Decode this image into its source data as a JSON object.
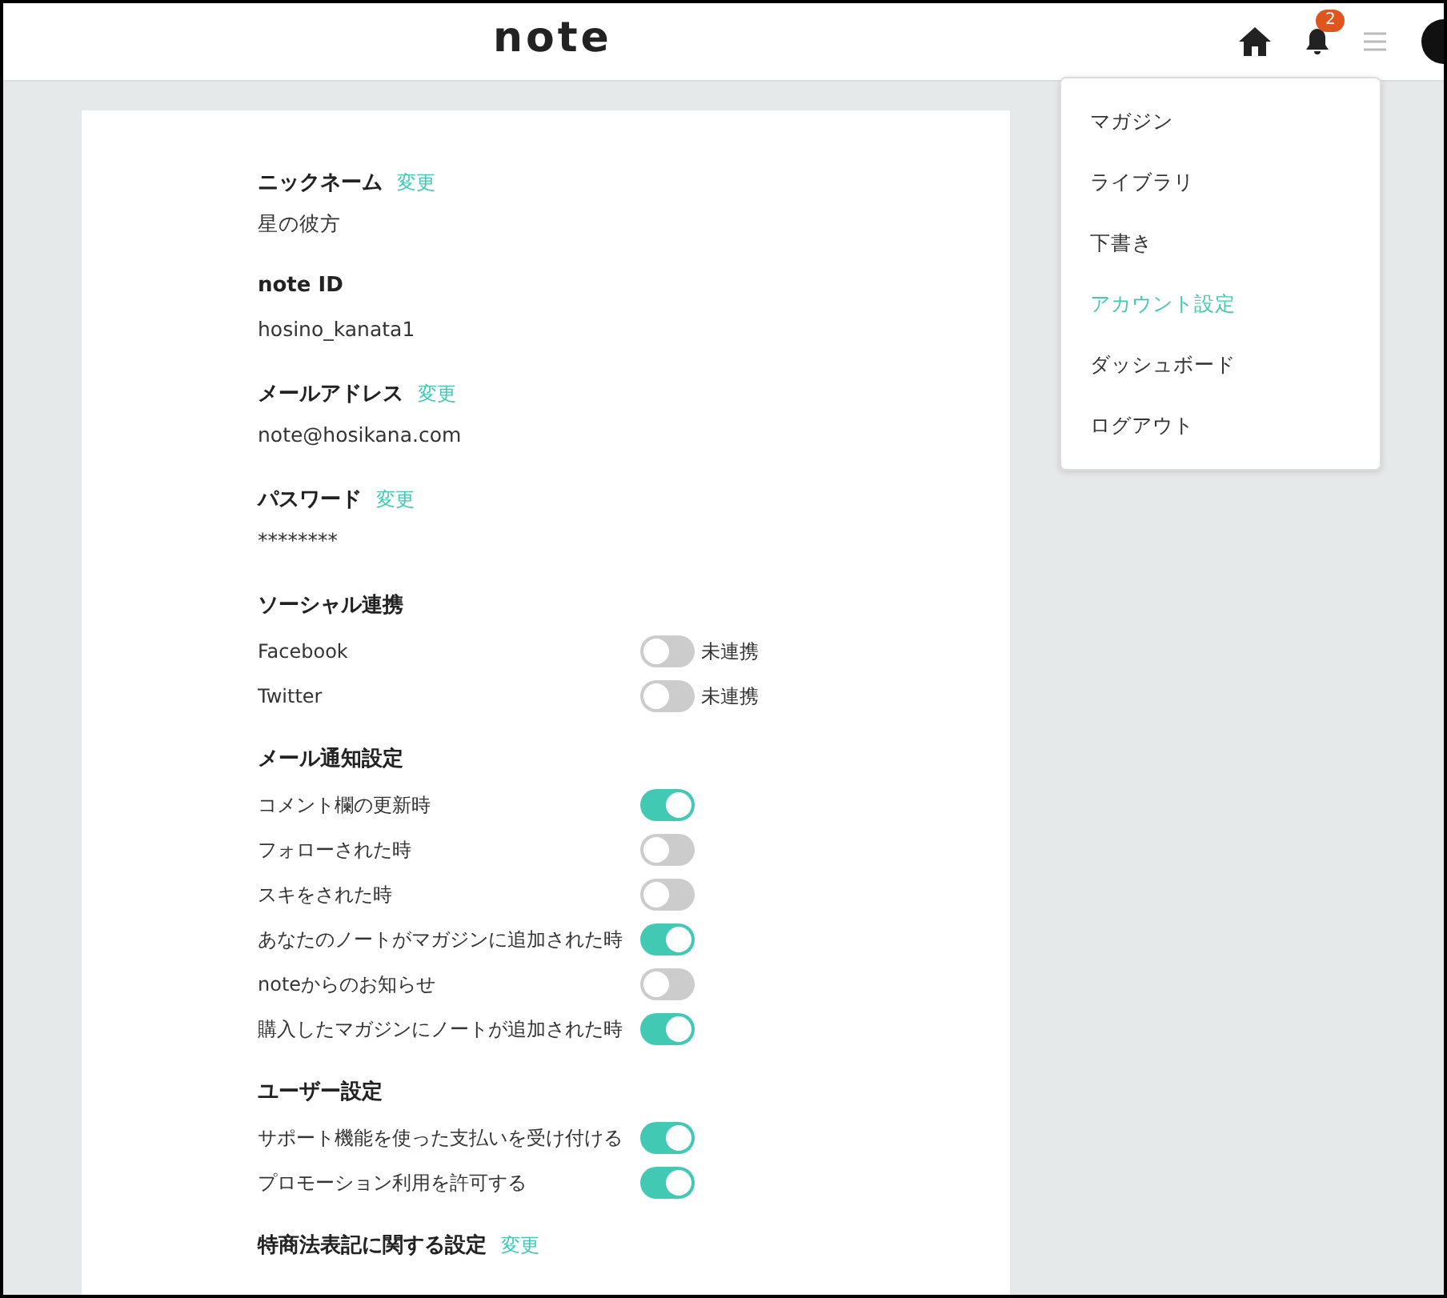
{
  "header": {
    "logo": "note",
    "notification_count": "2"
  },
  "sections": [
    {
      "kind": "field",
      "label": "ニックネーム",
      "action": "変更",
      "value": "星の彼方"
    },
    {
      "kind": "field",
      "label": "note ID",
      "value": "hosino_kanata1"
    },
    {
      "kind": "field",
      "label": "メールアドレス",
      "action": "変更",
      "value": "note@hosikana.com"
    },
    {
      "kind": "field",
      "label": "パスワード",
      "action": "変更",
      "value": "********"
    },
    {
      "kind": "toggles",
      "label": "ソーシャル連携",
      "rows": [
        {
          "label": "Facebook",
          "on": false,
          "status": "未連携"
        },
        {
          "label": "Twitter",
          "on": false,
          "status": "未連携"
        }
      ]
    },
    {
      "kind": "toggles",
      "label": "メール通知設定",
      "rows": [
        {
          "label": "コメント欄の更新時",
          "on": true
        },
        {
          "label": "フォローされた時",
          "on": false
        },
        {
          "label": "スキをされた時",
          "on": false
        },
        {
          "label": "あなたのノートがマガジンに追加された時",
          "on": true
        },
        {
          "label": "noteからのお知らせ",
          "on": false
        },
        {
          "label": "購入したマガジンにノートが追加された時",
          "on": true
        }
      ]
    },
    {
      "kind": "toggles",
      "label": "ユーザー設定",
      "rows": [
        {
          "label": "サポート機能を使った支払いを受け付ける",
          "on": true
        },
        {
          "label": "プロモーション利用を許可する",
          "on": true
        }
      ]
    },
    {
      "kind": "field",
      "label": "特商法表記に関する設定",
      "action": "変更"
    }
  ],
  "menu": [
    {
      "label": "マガジン",
      "selected": false
    },
    {
      "label": "ライブラリ",
      "selected": false
    },
    {
      "label": "下書き",
      "selected": false
    },
    {
      "label": "アカウント設定",
      "selected": true
    },
    {
      "label": "ダッシュボード",
      "selected": false
    },
    {
      "label": "ログアウト",
      "selected": false
    }
  ]
}
